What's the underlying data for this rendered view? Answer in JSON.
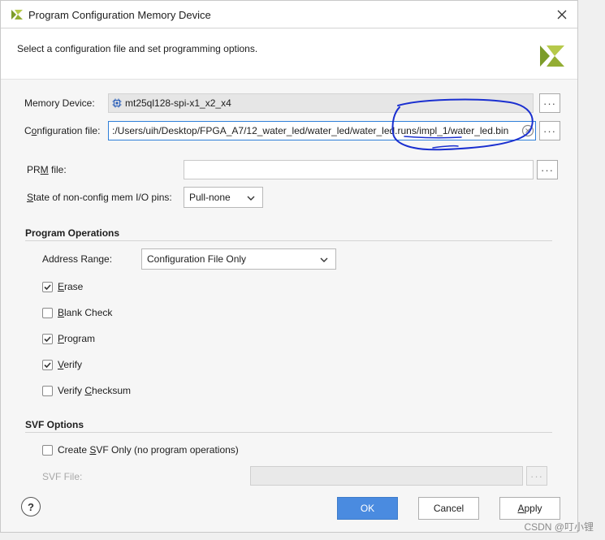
{
  "window": {
    "title": "Program Configuration Memory Device"
  },
  "header": {
    "instruction": "Select a configuration file and set programming options."
  },
  "memory_device": {
    "label": "Memory Device:",
    "value": "mt25ql128-spi-x1_x2_x4"
  },
  "configuration_file": {
    "label_pre": "C",
    "label_mn": "o",
    "label_post": "nfiguration file:",
    "value": ":/Users/uih/Desktop/FPGA_A7/12_water_led/water_led/water_led.runs/impl_1/water_led.bin"
  },
  "prm_file": {
    "label_pre": "PR",
    "label_mn": "M",
    "label_post": " file:",
    "value": ""
  },
  "io_pins": {
    "label_pre": "",
    "label_mn": "S",
    "label_post": "tate of non-config mem I/O pins:",
    "selected": "Pull-none"
  },
  "program_operations": {
    "title": "Program Operations",
    "address_range_label": "Address Range:",
    "address_range_selected": "Configuration File Only",
    "options": [
      {
        "pre": "",
        "mn": "E",
        "post": "rase",
        "checked": true
      },
      {
        "pre": "",
        "mn": "B",
        "post": "lank Check",
        "checked": false
      },
      {
        "pre": "",
        "mn": "P",
        "post": "rogram",
        "checked": true
      },
      {
        "pre": "",
        "mn": "V",
        "post": "erify",
        "checked": true
      },
      {
        "pre": "Verify ",
        "mn": "C",
        "post": "hecksum",
        "checked": false
      }
    ]
  },
  "svf_options": {
    "title": "SVF Options",
    "create_pre": "Create ",
    "create_mn": "S",
    "create_post": "VF Only (no program operations)",
    "create_checked": false,
    "file_label": "SVF File:",
    "file_value": ""
  },
  "buttons": {
    "help": "?",
    "ok": "OK",
    "cancel": "Cancel",
    "apply_mn": "A",
    "apply_post": "pply"
  },
  "watermark": "CSDN @叮小锂",
  "colors": {
    "primary": "#4a8be0",
    "focus": "#2f7fd9",
    "annotation": "#1a2fd0",
    "brand_green": "#7c9c2a"
  }
}
